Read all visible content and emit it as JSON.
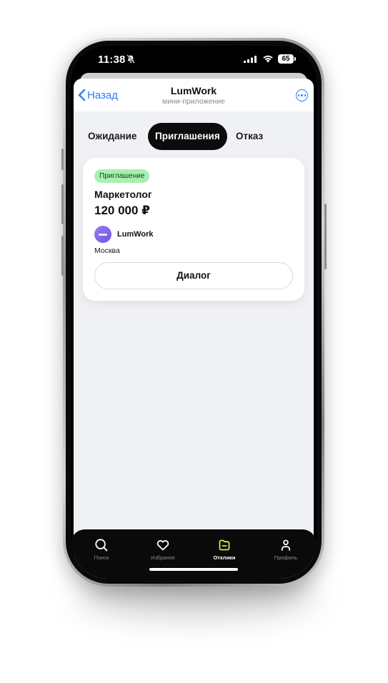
{
  "status_bar": {
    "time": "11:38",
    "battery": "65"
  },
  "nav": {
    "back_label": "Назад",
    "title": "LumWork",
    "subtitle": "мини-приложение"
  },
  "tabs": [
    {
      "label": "Ожидание",
      "active": false
    },
    {
      "label": "Приглашения",
      "active": true
    },
    {
      "label": "Отказ",
      "active": false
    }
  ],
  "card": {
    "badge": "Приглашение",
    "title": "Маркетолог",
    "salary": "120 000 ₽",
    "company": "LumWork",
    "city": "Москва",
    "dialog_button": "Диалог"
  },
  "tabbar": [
    {
      "label": "Поиск",
      "icon": "search-icon",
      "active": false
    },
    {
      "label": "Избраное",
      "icon": "heart-icon",
      "active": false
    },
    {
      "label": "Отклики",
      "icon": "responses-icon",
      "active": true
    },
    {
      "label": "Профиль",
      "icon": "profile-icon",
      "active": false
    }
  ],
  "colors": {
    "accent": "#2f7cf6",
    "badge_bg": "#a7f0b1",
    "active_tab_icon": "#c6f24d"
  }
}
